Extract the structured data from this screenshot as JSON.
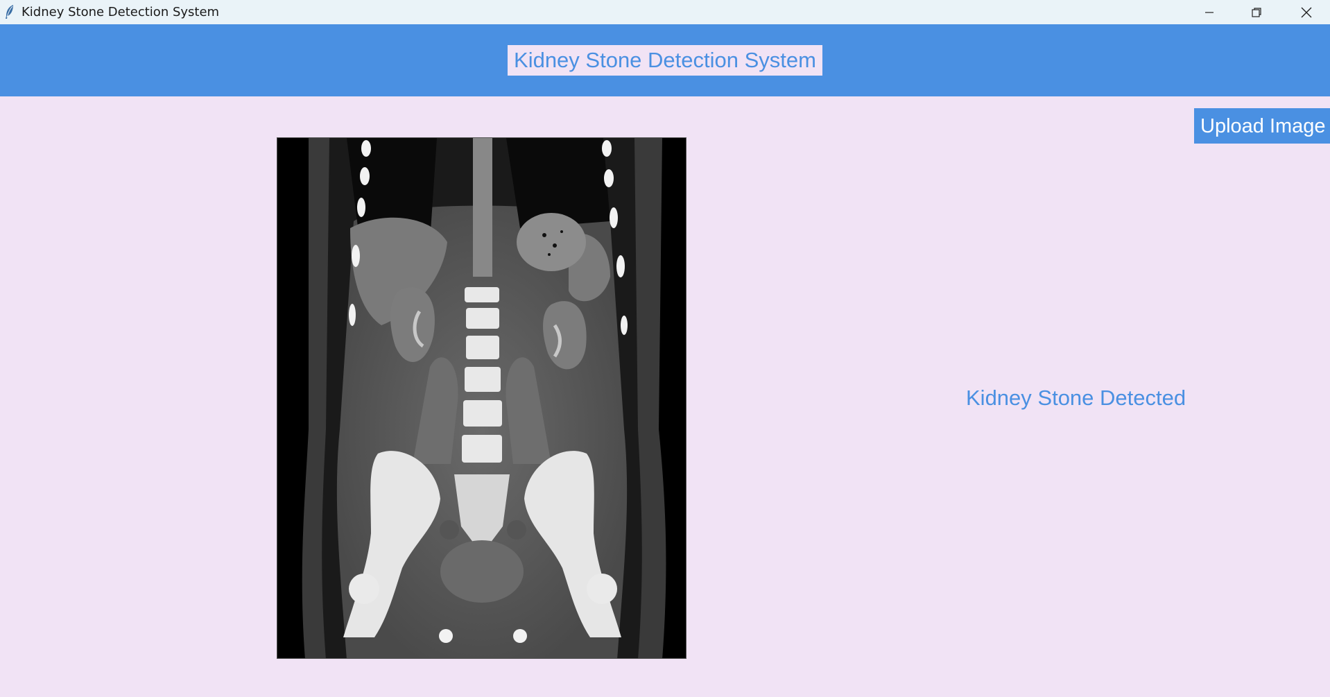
{
  "window": {
    "title": "Kidney Stone Detection System",
    "icon": "feather-icon",
    "controls": {
      "minimize_icon": "minimize-icon",
      "maximize_icon": "restore-icon",
      "close_icon": "close-icon"
    }
  },
  "header": {
    "title": "Kidney Stone Detection System"
  },
  "toolbar": {
    "upload_label": "Upload Image"
  },
  "image_panel": {
    "content": "ct-scan-image"
  },
  "result": {
    "text": "Kidney Stone Detected"
  },
  "colors": {
    "accent": "#4A90E2",
    "background": "#F1E3F5",
    "titlebar": "#EAF3F8",
    "button_text": "#FFFFFF"
  }
}
